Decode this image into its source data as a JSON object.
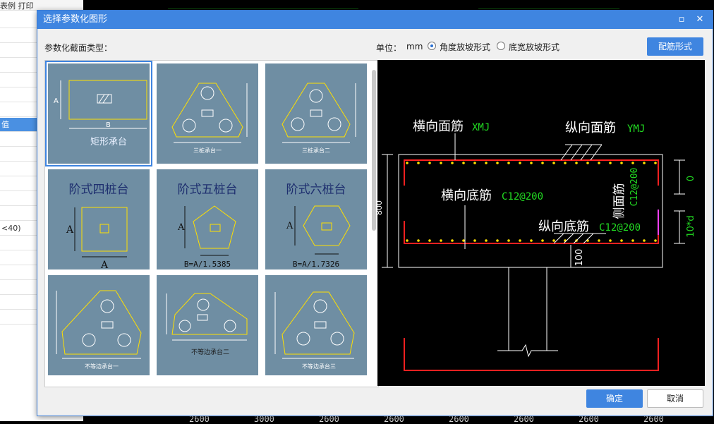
{
  "background": {
    "left_top_text": "表例 打印",
    "left_rows": [
      "",
      "",
      "",
      "",
      "",
      "",
      "",
      "值",
      "",
      "",
      "",
      "",
      "",
      "",
      "<40)",
      "",
      "",
      "",
      "",
      "",
      ""
    ],
    "cad_numbers": [
      "2600",
      "3000",
      "2600",
      "2600",
      "2600",
      "2600",
      "2600",
      "2600"
    ]
  },
  "dialog": {
    "title": "选择参数化图形",
    "section_label": "参数化截面类型：",
    "unit_label": "单位：",
    "unit_value": "mm",
    "radio_angle_label": "角度放坡形式",
    "radio_width_label": "底宽放坡形式",
    "config_button": "配筋形式",
    "ok_button": "确定",
    "cancel_button": "取消"
  },
  "gallery": {
    "tiles": [
      {
        "caption": "矩形承台",
        "dim_a": "A",
        "dim_b": "B"
      },
      {
        "caption": "三桩承台一"
      },
      {
        "caption": "三桩承台二"
      },
      {
        "caption": "阶式四桩台",
        "dim_a": "A",
        "dim_b": "A"
      },
      {
        "caption": "阶式五桩台",
        "dim_a": "A",
        "dim_b": "B=A/1.5385"
      },
      {
        "caption": "阶式六桩台",
        "dim_a": "A",
        "dim_b": "B=A/1.7326"
      },
      {
        "caption": "不等边承台一"
      },
      {
        "caption": "不等边承台二"
      },
      {
        "caption": "不等边承台三"
      }
    ]
  },
  "preview": {
    "label_top_transverse": "横向面筋",
    "value_top_transverse": "XMJ",
    "label_top_longitudinal": "纵向面筋",
    "value_top_longitudinal": "YMJ",
    "label_bottom_transverse": "横向底筋",
    "value_bottom_transverse": "C12@200",
    "label_bottom_longitudinal": "纵向底筋",
    "value_bottom_longitudinal": "C12@200",
    "label_side": "侧面筋",
    "value_side": "C12@200",
    "dim_top": "0",
    "dim_side": "10*d",
    "dim_bottom": "100",
    "dim_height": "800"
  },
  "colors": {
    "accent": "#3f85e0",
    "tile_bg": "#6f8ea3",
    "rebar_red": "#ff2020",
    "rebar_dot": "#ffe000",
    "label_green": "#22dd22"
  }
}
